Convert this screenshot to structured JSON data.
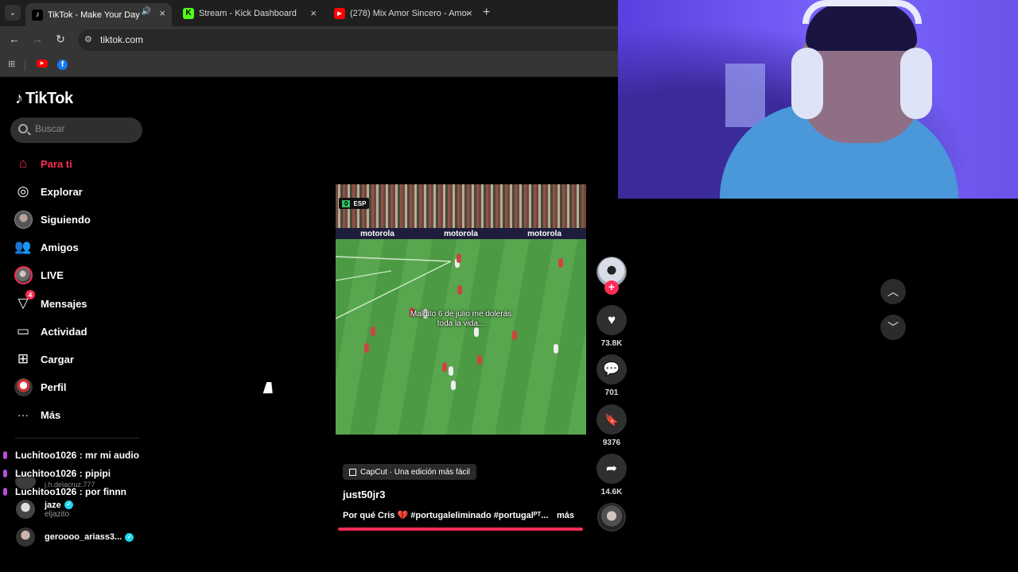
{
  "browser": {
    "tabs": [
      {
        "title": "TikTok - Make Your Day",
        "icon": "tiktok-favicon",
        "active": true
      },
      {
        "title": "Stream - Kick Dashboard",
        "icon": "kick-favicon",
        "active": false
      },
      {
        "title": "(278) Mix Amor Sincero - Amor",
        "icon": "youtube-favicon",
        "active": false
      }
    ],
    "url": "tiktok.com",
    "accent": "#1f1f1f"
  },
  "sidebar": {
    "logo": "TikTok",
    "search_placeholder": "Buscar",
    "nav": [
      {
        "label": "Para ti",
        "icon": "home-icon",
        "active": true
      },
      {
        "label": "Explorar",
        "icon": "compass-icon",
        "active": false
      },
      {
        "label": "Siguiendo",
        "icon": "following-avatar-icon",
        "active": false
      },
      {
        "label": "Amigos",
        "icon": "friends-icon",
        "active": false
      },
      {
        "label": "LIVE",
        "icon": "live-avatar-icon",
        "active": false
      },
      {
        "label": "Mensajes",
        "icon": "messages-icon",
        "active": false,
        "badge": "4"
      },
      {
        "label": "Actividad",
        "icon": "activity-icon",
        "active": false
      },
      {
        "label": "Cargar",
        "icon": "upload-icon",
        "active": false
      },
      {
        "label": "Perfil",
        "icon": "profile-avatar-icon",
        "active": false
      },
      {
        "label": "Más",
        "icon": "more-icon",
        "active": false
      }
    ],
    "following": [
      {
        "name": "jaze",
        "handle": "eljazito",
        "verified": true
      },
      {
        "name": "geroooo_ariass3...",
        "handle": "",
        "verified": true
      }
    ],
    "partial_handle": "j.h.delacruz.777"
  },
  "chat": [
    {
      "user": "Luchitoo1026",
      "message": "mr mi audio"
    },
    {
      "user": "Luchitoo1026",
      "message": "pipipi"
    },
    {
      "user": "Luchitoo1026",
      "message": "por finnn"
    }
  ],
  "video": {
    "scorebug": {
      "score": "0",
      "team": "ESP"
    },
    "ad_text": "motorola",
    "caption_line1": "Maldito 6 de julio me dolerás",
    "caption_line2": "toda la vida...",
    "capcut_label": "CapCut · Una edición más fácil",
    "author": "just50jr3",
    "description": "Por qué Cris",
    "hashtags": "#portugaleliminado #portugalᴾᵀ...",
    "more": "más",
    "progress": 1.0
  },
  "actions": {
    "likes": "73.8K",
    "comments": "701",
    "saves": "9376",
    "shares": "14.6K"
  },
  "colors": {
    "brand": "#fe2c55",
    "verified": "#20d5ec"
  }
}
